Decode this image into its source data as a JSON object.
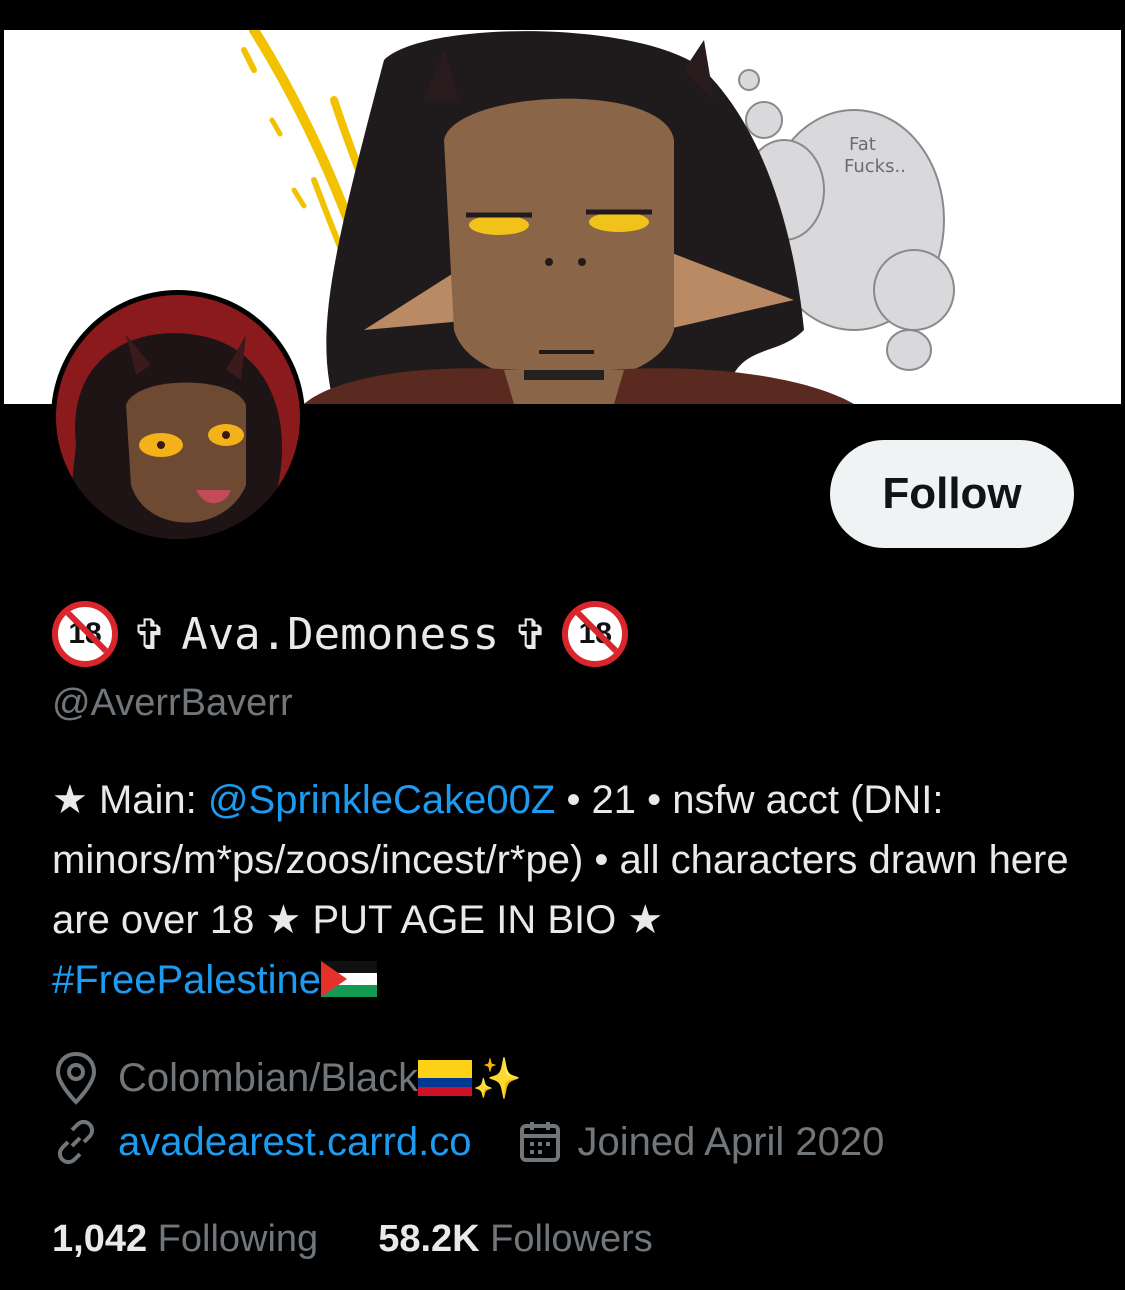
{
  "profile": {
    "display_name": "Ava.Demoness",
    "cross_glyph": "✞",
    "age_badge": "18",
    "handle": "@AverrBaverr",
    "follow_label": "Follow"
  },
  "bio": {
    "star": "★",
    "main_prefix": " Main: ",
    "main_link": "@SprinkleCake00Z",
    "line_rest": " • 21 • nsfw acct (DNI: minors/m*ps/zoos/incest/r*pe) • all characters drawn here are over 18 ",
    "star2": "★",
    "put_age": " PUT AGE IN BIO ",
    "star3": "★",
    "hashtag": "#FreePalestine"
  },
  "meta": {
    "location": "Colombian/Black",
    "sparkles": "✨",
    "website": "avadearest.carrd.co",
    "joined": "Joined April 2020",
    "icons": [
      "location-pin-icon",
      "link-icon",
      "calendar-icon"
    ]
  },
  "stats": {
    "following_count": "1,042",
    "following_label": "Following",
    "followers_count": "58.2K",
    "followers_label": "Followers"
  },
  "banner": {
    "doodle_text_1": "Fat",
    "doodle_text_2": "Fucks.."
  },
  "colors": {
    "link": "#1d9bf0",
    "muted": "#71767b",
    "text": "#e7e9ea",
    "background": "#000000"
  }
}
